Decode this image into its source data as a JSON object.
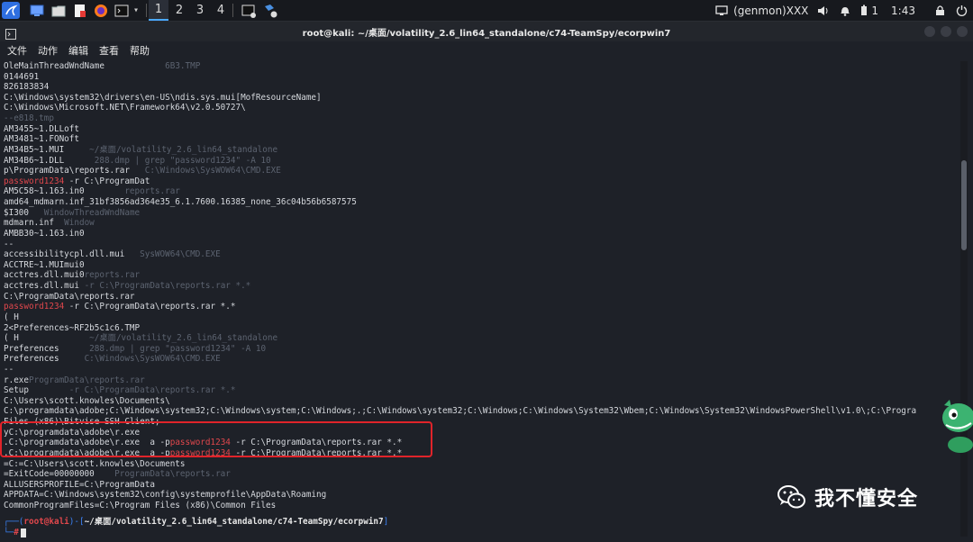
{
  "panel": {
    "workspaces": [
      "1",
      "2",
      "3",
      "4"
    ],
    "tray": {
      "user": "(genmon)XXX",
      "notif_count": "1",
      "time": "1:43"
    }
  },
  "window": {
    "title": "root@kali: ~/桌面/volatility_2.6_lin64_standalone/c74-TeamSpy/ecorpwin7"
  },
  "menu": [
    "文件",
    "动作",
    "编辑",
    "查看",
    "帮助"
  ],
  "terminal": {
    "lines": [
      {
        "t": "OleMainThreadWndName",
        "g": "            6B3.TMP"
      },
      {
        "t": "0144691"
      },
      {
        "t": "826183834"
      },
      {
        "t": "C:\\Windows\\system32\\drivers\\en-US\\ndis.sys.mui[MofResourceName]"
      },
      {
        "t": "C:\\Windows\\Microsoft.NET\\Framework64\\v2.0.50727\\"
      },
      {
        "t": "",
        "g": "--e818.tmp"
      },
      {
        "t": "AM3455~1.DLLoft"
      },
      {
        "t": "AM3481~1.FONoft"
      },
      {
        "t": "AM34B5~1.MUI",
        "g": "     ~/桌面/volatility_2.6_lin64_standalone"
      },
      {
        "t": "AM34B6~1.DLL",
        "g": "      288.dmp | grep \"password1234\" -A 10"
      },
      {
        "t": "p\\ProgramData\\reports.rar",
        "g": "   C:\\Windows\\SysWOW64\\CMD.EXE"
      },
      {
        "t": "",
        "r": "password1234",
        "a": " -r C:\\ProgramDat"
      },
      {
        "t": "AM5C58~1.163.in0",
        "g": "        reports.rar"
      },
      {
        "t": "amd64_mdmarn.inf_31bf3856ad364e35_6.1.7600.16385_none_36c04b56b6587575"
      },
      {
        "t": "$I300",
        "g": "   WindowThreadWndName"
      },
      {
        "t": "mdmarn.inf",
        "g": "  Window"
      },
      {
        "t": "AMBB30~1.163.in0"
      },
      {
        "t": "--"
      },
      {
        "t": "accessibilitycpl.dll.mui",
        "g": "   SysWOW64\\CMD.EXE"
      },
      {
        "t": "ACCTRE~1.MUImui0"
      },
      {
        "t": "acctres.dll.mui0",
        "g": "reports.rar"
      },
      {
        "t": "acctres.dll.mui",
        "g": " -r C:\\ProgramData\\reports.rar *.*"
      },
      {
        "t": "C:\\ProgramData\\reports.rar"
      },
      {
        "t": "",
        "r": "password1234",
        "a": " -r C:\\ProgramData\\reports.rar *.*"
      },
      {
        "t": "( H"
      },
      {
        "t": "2<Preferences~RF2b5c1c6.TMP"
      },
      {
        "t": "( H",
        "g": "              ~/桌面/volatility_2.6_lin64_standalone"
      },
      {
        "t": "Preferences",
        "g": "      288.dmp | grep \"password1234\" -A 10"
      },
      {
        "t": "Preferences",
        "g": "     C:\\Windows\\SysWOW64\\CMD.EXE"
      },
      {
        "t": "--"
      },
      {
        "t": "r.exe",
        "g": "ProgramData\\reports.rar"
      },
      {
        "t": "Setup",
        "g": "        -r C:\\ProgramData\\reports.rar *.*"
      },
      {
        "t": "C:\\Users\\scott.knowles\\Documents\\"
      },
      {
        "t": "C:\\programdata\\adobe;C:\\Windows\\system32;C:\\Windows\\system;C:\\Windows;.;C:\\Windows\\system32;C:\\Windows;C:\\Windows\\System32\\Wbem;C:\\Windows\\System32\\WindowsPowerShell\\v1.0\\;C:\\Progra"
      },
      {
        "t": "Files (x86)\\Bitvise SSH Client;"
      },
      {
        "t": "yC:\\programdata\\adobe\\r.exe"
      },
      {
        "t": ".C:\\programdata\\adobe\\r.exe  a -p",
        "r": "password1234",
        "a": " -r C:\\ProgramData\\reports.rar *.*"
      },
      {
        "t": ".C:\\programdata\\adobe\\r.exe  a -p",
        "r": "password1234",
        "a": " -r C:\\ProgramData\\reports.rar *.*"
      },
      {
        "t": "=C:=C:\\Users\\scott.knowles\\Documents"
      },
      {
        "t": "=ExitCode=00000000",
        "g": "    ProgramData\\reports.rar"
      },
      {
        "t": "ALLUSERSPROFILE=C:\\ProgramData"
      },
      {
        "t": "APPDATA=C:\\Windows\\system32\\config\\systemprofile\\AppData\\Roaming"
      },
      {
        "t": "CommonProgramFiles=C:\\Program Files (x86)\\Common Files"
      }
    ],
    "prompt": {
      "user": "root",
      "at": "@",
      "host": "kali",
      "path": "~/桌面/volatility_2.6_lin64_standalone/c74-TeamSpy/ecorpwin7",
      "symbol": "#"
    }
  },
  "watermark": {
    "text": "我不懂安全"
  },
  "colors": {
    "terminal_bg": "#1e2128",
    "text": "#d6d9de",
    "highlight_red": "#e0474c",
    "box_red": "#e0242a",
    "prompt_blue": "#3b82f6"
  }
}
